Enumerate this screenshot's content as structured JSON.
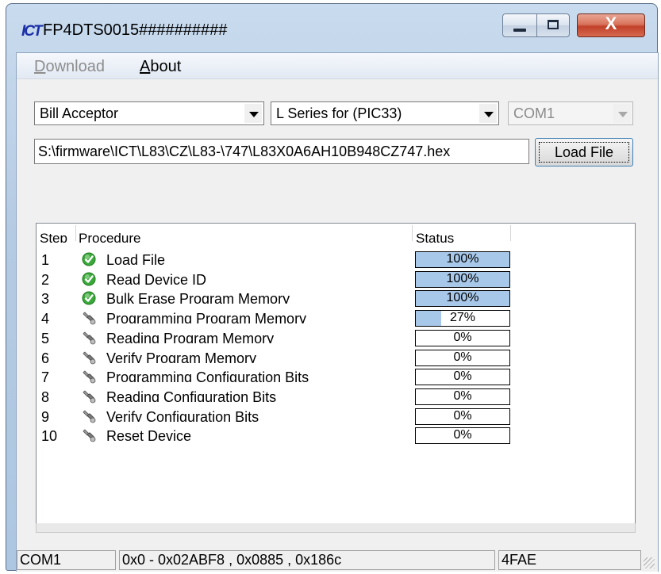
{
  "window": {
    "title": "FP4DTS0015##########",
    "logo": "ICT",
    "close_glyph": "X"
  },
  "menu": {
    "download": "Download",
    "about": "About"
  },
  "controls": {
    "device_type": "Bill Acceptor",
    "series": "L Series for (PIC33)",
    "com_port": "COM1",
    "file_path": "S:\\firmware\\ICT\\L83\\CZ\\L83-\\747\\L83X0A6AH10B948CZ747.hex",
    "load_button": "Load File"
  },
  "list": {
    "columns": {
      "step": "Step",
      "procedure": "Procedure",
      "status": "Status"
    },
    "rows": [
      {
        "step": "1",
        "procedure": "Load File",
        "icon": "check-icon",
        "progress": 100,
        "status": "100%"
      },
      {
        "step": "2",
        "procedure": "Read Device ID",
        "icon": "check-icon",
        "progress": 100,
        "status": "100%"
      },
      {
        "step": "3",
        "procedure": "Bulk Erase Program Memory",
        "icon": "check-icon",
        "progress": 100,
        "status": "100%"
      },
      {
        "step": "4",
        "procedure": "Programming Program Memory",
        "icon": "wrench-icon",
        "progress": 27,
        "status": "27%"
      },
      {
        "step": "5",
        "procedure": "Reading Program Memory",
        "icon": "wrench-icon",
        "progress": 0,
        "status": "0%"
      },
      {
        "step": "6",
        "procedure": "Verify Program Memory",
        "icon": "wrench-icon",
        "progress": 0,
        "status": "0%"
      },
      {
        "step": "7",
        "procedure": "Programming Configuration Bits",
        "icon": "wrench-icon",
        "progress": 0,
        "status": "0%"
      },
      {
        "step": "8",
        "procedure": "Reading Configuration Bits",
        "icon": "wrench-icon",
        "progress": 0,
        "status": "0%"
      },
      {
        "step": "9",
        "procedure": "Verify Configuration Bits",
        "icon": "wrench-icon",
        "progress": 0,
        "status": "0%"
      },
      {
        "step": "10",
        "procedure": "Reset Device",
        "icon": "wrench-icon",
        "progress": 0,
        "status": "0%"
      }
    ]
  },
  "statusbar": {
    "port": "COM1",
    "info": "0x0 - 0x02ABF8 , 0x0885 , 0x186c",
    "checksum": "4FAE"
  },
  "colors": {
    "progress_fill": "#a8c8ea",
    "check": "#3aa93a",
    "titlebar": "#b5cbe3"
  }
}
